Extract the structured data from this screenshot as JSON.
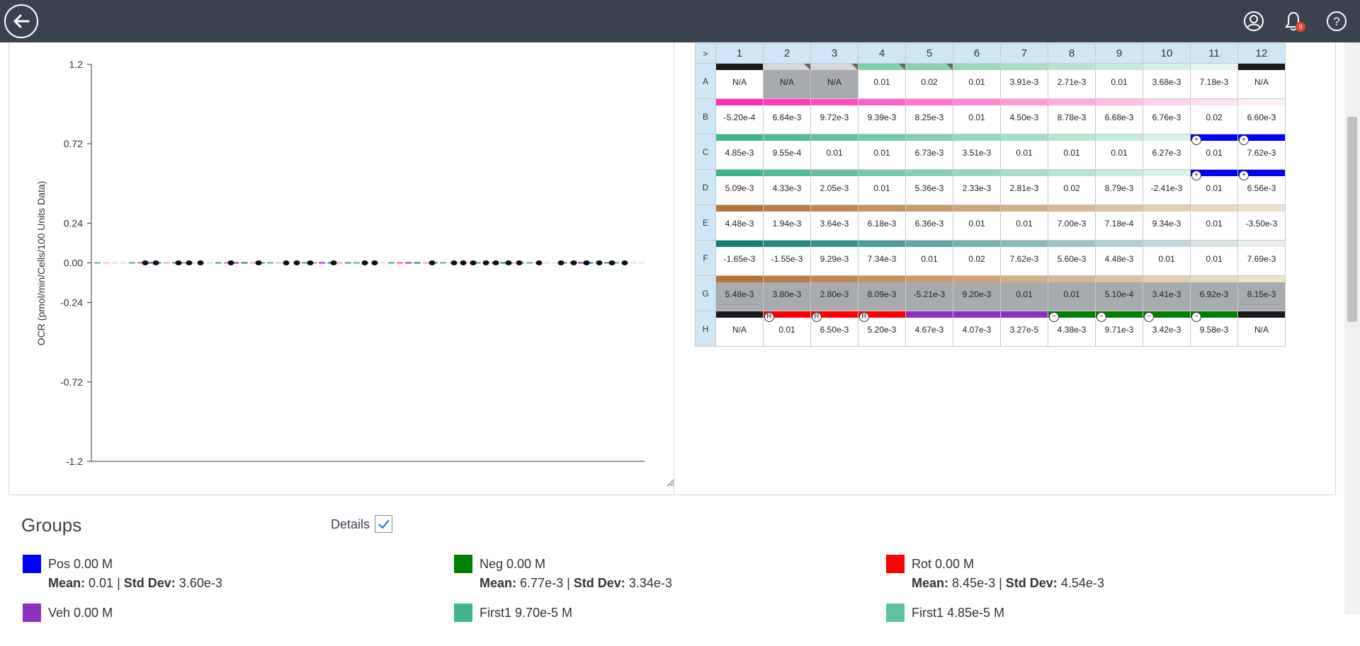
{
  "topbar": {
    "back_icon": "arrow-left-circle-icon",
    "notification_count": "9",
    "icons": [
      "user-circle-icon",
      "bell-icon",
      "help-circle-icon"
    ]
  },
  "chart_data": {
    "type": "scatter",
    "ylabel": "OCR (pmol/min/Cells/100 Units Data)",
    "xlabel": "",
    "ylim": [
      -1.2,
      1.2
    ],
    "yticks": [
      "1.2",
      "0.72",
      "0.24",
      "0.00",
      "-0.24",
      "-0.72",
      "-1.2"
    ],
    "ytick_values": [
      1.2,
      0.72,
      0.24,
      0.0,
      -0.24,
      -0.72,
      -1.2
    ],
    "points_y": [
      0,
      0,
      0,
      0,
      0,
      0,
      0,
      0,
      0,
      0,
      0,
      0,
      0,
      0,
      0,
      0,
      0,
      0,
      0,
      0,
      0,
      0,
      0,
      0,
      0,
      0,
      0,
      0,
      0,
      0,
      0,
      0
    ],
    "bar_colors": [
      "#4fb3b0",
      "#f7b8dd",
      "#c8eaea",
      "#e0e0e0",
      "#3aaa8c",
      "#ff4ec0",
      "#9a2fbf",
      "#0f8a80",
      "#ff9fd8",
      "#2e9b7b"
    ]
  },
  "plate": {
    "corner": ">",
    "columns": [
      "1",
      "2",
      "3",
      "4",
      "5",
      "6",
      "7",
      "8",
      "9",
      "10",
      "11",
      "12"
    ],
    "rows": [
      {
        "label": "A",
        "values": [
          "N/A",
          "N/A",
          "N/A",
          "0.01",
          "0.02",
          "0.01",
          "3.91e-3",
          "2.71e-3",
          "0.01",
          "3.68e-3",
          "7.18e-3",
          "N/A"
        ],
        "colors": [
          "#1a1a1a",
          "#d6d6d6",
          "#d6d6d6",
          "#7fcfa8",
          "#88d2ae",
          "#99d8b9",
          "#a8dec4",
          "#b7e4cf",
          "#c6eada",
          "#d5f0e4",
          "#e4f5ee",
          "#1a1a1a"
        ],
        "grey": [
          false,
          true,
          true,
          false,
          false,
          false,
          false,
          false,
          false,
          false,
          false,
          false
        ]
      },
      {
        "label": "B",
        "values": [
          "-5.20e-4",
          "6.64e-3",
          "9.72e-3",
          "9.39e-3",
          "8.25e-3",
          "0.01",
          "4.50e-3",
          "8.78e-3",
          "6.68e-3",
          "6.76e-3",
          "0.02",
          "6.60e-3"
        ],
        "colors": [
          "#ff2eb4",
          "#ff3db9",
          "#ff4fbf",
          "#ff62c6",
          "#ff74cc",
          "#ff87d2",
          "#ff99d9",
          "#ffabdf",
          "#ffbde5",
          "#ffcfec",
          "#ffe0f2",
          "#fff0f8"
        ],
        "grey": [
          false,
          false,
          false,
          false,
          false,
          false,
          false,
          false,
          false,
          false,
          false,
          false
        ]
      },
      {
        "label": "C",
        "values": [
          "4.85e-3",
          "9.55e-4",
          "0.01",
          "0.01",
          "6.73e-3",
          "3.51e-3",
          "0.01",
          "0.01",
          "0.01",
          "6.27e-3",
          "0.01",
          "7.62e-3"
        ],
        "colors": [
          "#3fb58a",
          "#50bc94",
          "#61c39e",
          "#72caa8",
          "#83d1b2",
          "#94d8bc",
          "#a5dfc6",
          "#b6e6d0",
          "#c7edda",
          "#d8f4e4",
          "#0000ff",
          "#0000ff"
        ],
        "grey": [
          false,
          false,
          false,
          false,
          false,
          false,
          false,
          false,
          false,
          false,
          false,
          false
        ],
        "marks": [
          null,
          null,
          null,
          null,
          null,
          null,
          null,
          null,
          null,
          null,
          "+",
          "+"
        ]
      },
      {
        "label": "D",
        "values": [
          "5.09e-3",
          "4.33e-3",
          "2.05e-3",
          "0.01",
          "5.36e-3",
          "2.33e-3",
          "2.81e-3",
          "0.02",
          "8.79e-3",
          "-2.41e-3",
          "0.01",
          "6.56e-3"
        ],
        "colors": [
          "#3fb58a",
          "#50bc94",
          "#61c39e",
          "#72caa8",
          "#83d1b2",
          "#94d8bc",
          "#a5dfc6",
          "#b6e6d0",
          "#c7edda",
          "#d8f4e4",
          "#0000ff",
          "#0000ff"
        ],
        "grey": [
          false,
          false,
          false,
          false,
          false,
          false,
          false,
          false,
          false,
          false,
          false,
          false
        ],
        "marks": [
          null,
          null,
          null,
          null,
          null,
          null,
          null,
          null,
          null,
          null,
          "+",
          "+"
        ]
      },
      {
        "label": "E",
        "values": [
          "4.48e-3",
          "1.94e-3",
          "3.64e-3",
          "6.18e-3",
          "6.36e-3",
          "0.01",
          "0.01",
          "7.00e-3",
          "7.18e-4",
          "9.34e-3",
          "0.01",
          "-3.50e-3"
        ],
        "colors": [
          "#b5733a",
          "#ba7d47",
          "#bf8754",
          "#c49161",
          "#c99b6e",
          "#cea57b",
          "#d3af88",
          "#d8b995",
          "#ddc3a2",
          "#e2cdaf",
          "#e7d7bc",
          "#ece1c9"
        ],
        "grey": [
          false,
          false,
          false,
          false,
          false,
          false,
          false,
          false,
          false,
          false,
          false,
          false
        ]
      },
      {
        "label": "F",
        "values": [
          "-1.65e-3",
          "-1.55e-3",
          "9.29e-3",
          "7.34e-3",
          "0.01",
          "0.02",
          "7.62e-3",
          "5.60e-3",
          "4.48e-3",
          "0.01",
          "0.01",
          "7.69e-3"
        ],
        "colors": [
          "#0f7f78",
          "#238983",
          "#37938e",
          "#4b9d99",
          "#5fa7a4",
          "#73b1af",
          "#87bbba",
          "#9bc5c5",
          "#afd0d0",
          "#c3dadb",
          "#d7e4e6",
          "#ebeef1"
        ],
        "grey": [
          false,
          false,
          false,
          false,
          false,
          false,
          false,
          false,
          false,
          false,
          false,
          false
        ]
      },
      {
        "label": "G",
        "values": [
          "5.48e-3",
          "3.80e-3",
          "2.80e-3",
          "8.09e-3",
          "-5.21e-3",
          "9.20e-3",
          "0.01",
          "0.01",
          "5.10e-4",
          "3.41e-3",
          "6.92e-3",
          "8.15e-3"
        ],
        "colors": [
          "#b5733a",
          "#ba7d47",
          "#bf8754",
          "#c49161",
          "#c99b6e",
          "#cea57b",
          "#d3af88",
          "#d8b995",
          "#ddc3a2",
          "#e2cdaf",
          "#e7d7bc",
          "#ece1c9"
        ],
        "grey": [
          true,
          true,
          true,
          true,
          true,
          true,
          true,
          true,
          true,
          true,
          true,
          true
        ]
      },
      {
        "label": "H",
        "values": [
          "N/A",
          "0.01",
          "6.50e-3",
          "5.20e-3",
          "4.67e-3",
          "4.07e-3",
          "3.27e-5",
          "4.38e-3",
          "9.71e-3",
          "3.42e-3",
          "9.58e-3",
          "N/A"
        ],
        "colors": [
          "#1a1a1a",
          "#ff0000",
          "#ff0000",
          "#ff0000",
          "#8f2fbf",
          "#8f2fbf",
          "#8f2fbf",
          "#008000",
          "#008000",
          "#008000",
          "#008000",
          "#1a1a1a"
        ],
        "grey": [
          false,
          false,
          false,
          false,
          false,
          false,
          false,
          false,
          false,
          false,
          false,
          false
        ],
        "marks": [
          null,
          "R",
          "R",
          "R",
          null,
          null,
          null,
          "−",
          "−",
          "−",
          "−",
          null
        ]
      }
    ]
  },
  "groups": {
    "title": "Groups",
    "details_label": "Details",
    "details_checked": true,
    "items": [
      {
        "name": "Pos 0.00 M",
        "mean_label": "Mean:",
        "mean": "0.01",
        "std_label": "Std Dev:",
        "std": "3.60e-3",
        "color": "#0000ff"
      },
      {
        "name": "Neg 0.00 M",
        "mean_label": "Mean:",
        "mean": "6.77e-3",
        "std_label": "Std Dev:",
        "std": "3.34e-3",
        "color": "#008000"
      },
      {
        "name": "Rot 0.00 M",
        "mean_label": "Mean:",
        "mean": "8.45e-3",
        "std_label": "Std Dev:",
        "std": "4.54e-3",
        "color": "#ff0000"
      },
      {
        "name": "Veh 0.00 M",
        "color": "#8f2fbf"
      },
      {
        "name": "First1 9.70e-5 M",
        "color": "#3fb58a"
      },
      {
        "name": "First1 4.85e-5 M",
        "color": "#5ec39c"
      }
    ]
  }
}
